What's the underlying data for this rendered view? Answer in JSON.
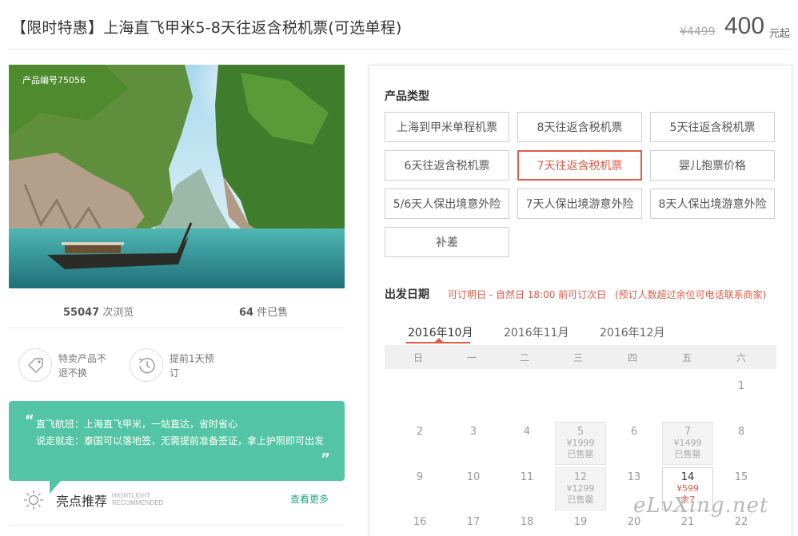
{
  "header": {
    "title": "【限时特惠】上海直飞甲米5-8天往返含税机票(可选单程)",
    "original_price": "¥4499",
    "price": "400",
    "price_unit": "元起"
  },
  "product": {
    "code_label": "产品编号75056",
    "views_count": "55047",
    "views_label": "次浏览",
    "sold_count": "64",
    "sold_label": "件已售"
  },
  "features": [
    {
      "icon": "tag-icon",
      "text": "特卖产品不退不换"
    },
    {
      "icon": "history-clock-icon",
      "text": "提前1天预订"
    }
  ],
  "highlights": {
    "line1": "直飞航班：上海直飞甲米，一站直达，省时省心",
    "line2": "说走就走：泰国可以落地签，无需提前准备签证，拿上护照即可出发",
    "title": "亮点推荐",
    "title_en_1": "HIGHTLIGHT",
    "title_en_2": "RECOMMENDED",
    "more_label": "查看更多",
    "accent_color": "#53c5a6"
  },
  "product_type": {
    "label": "产品类型",
    "options": [
      "上海到甲米单程机票",
      "8天往返含税机票",
      "5天往返含税机票",
      "6天往返含税机票",
      "7天往返含税机票",
      "婴儿抱票价格",
      "5/6天人保出境意外险",
      "7天人保出境游意外险",
      "8天人保出境游意外险",
      "补差"
    ],
    "selected": "7天往返含税机票"
  },
  "departure": {
    "label": "出发日期",
    "note1": "可订明日 - 自然日 18:00 前可订次日",
    "note2": "(预订人数超过余位可电话联系商家)",
    "months": [
      "2016年10月",
      "2016年11月",
      "2016年12月"
    ],
    "active_month": "2016年10月",
    "weekdays": [
      "日",
      "一",
      "二",
      "三",
      "四",
      "五",
      "六"
    ],
    "days": {
      "d1": "1",
      "d2": "2",
      "d3": "3",
      "d4": "4",
      "d5": "5",
      "d6": "6",
      "d7": "7",
      "d8": "8",
      "d9": "9",
      "d10": "10",
      "d11": "11",
      "d12": "12",
      "d13": "13",
      "d14": "14",
      "d15": "15",
      "d16": "16",
      "d17": "17",
      "d18": "18",
      "d19": "19",
      "d20": "20",
      "d21": "21",
      "d22": "22"
    },
    "day5": {
      "price": "¥1999",
      "status": "已售罄"
    },
    "day7": {
      "price": "¥1499",
      "status": "已售罄"
    },
    "day12": {
      "price": "¥1299",
      "status": "已售罄"
    },
    "day14": {
      "price": "¥599",
      "status": "余7"
    }
  },
  "watermark": "eLvXing.net",
  "colors": {
    "accent_red": "#e05a47",
    "teal": "#53c5a6"
  }
}
